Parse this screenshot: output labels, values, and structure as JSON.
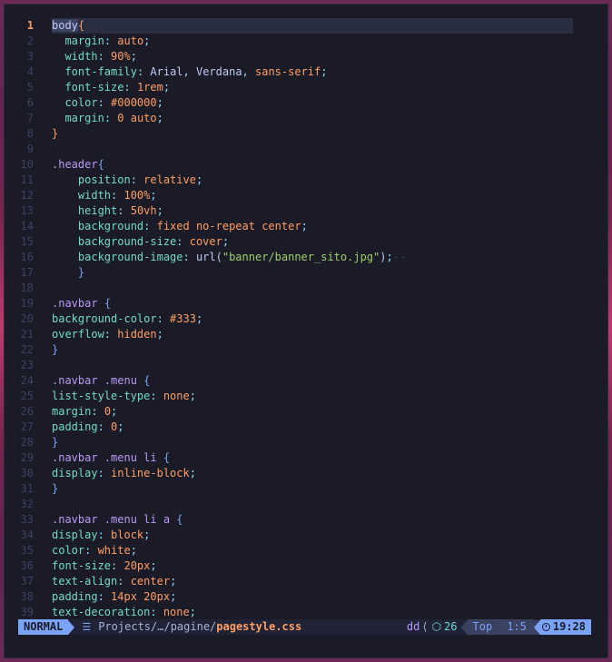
{
  "colors": {
    "background": "#1a1b26",
    "accent": "#7aa2f7",
    "selector": "#bb9af7",
    "property": "#7dcfff",
    "value": "#ff9e64",
    "string": "#9ece6a"
  },
  "editor": {
    "current_line": 1,
    "lines": [
      {
        "n": "1",
        "tokens": [
          [
            "t-hl",
            "body"
          ],
          [
            "t-brace",
            "{"
          ]
        ]
      },
      {
        "n": "2",
        "tokens": [
          [
            "t-plain",
            "  "
          ],
          [
            "t-prop2",
            "margin"
          ],
          [
            "t-punct",
            ": "
          ],
          [
            "t-val",
            "auto"
          ],
          [
            "t-punct",
            ";"
          ]
        ]
      },
      {
        "n": "3",
        "tokens": [
          [
            "t-plain",
            "  "
          ],
          [
            "t-prop2",
            "width"
          ],
          [
            "t-punct",
            ": "
          ],
          [
            "t-num",
            "90%"
          ],
          [
            "t-punct",
            ";"
          ]
        ]
      },
      {
        "n": "4",
        "tokens": [
          [
            "t-plain",
            "  "
          ],
          [
            "t-prop2",
            "font-family"
          ],
          [
            "t-punct",
            ": "
          ],
          [
            "t-plain",
            "Arial"
          ],
          [
            "t-comma",
            ", "
          ],
          [
            "t-plain",
            "Verdana"
          ],
          [
            "t-comma",
            ", "
          ],
          [
            "t-val",
            "sans-serif"
          ],
          [
            "t-punct",
            ";"
          ]
        ]
      },
      {
        "n": "5",
        "tokens": [
          [
            "t-plain",
            "  "
          ],
          [
            "t-prop2",
            "font-size"
          ],
          [
            "t-punct",
            ": "
          ],
          [
            "t-num",
            "1rem"
          ],
          [
            "t-punct",
            ";"
          ]
        ]
      },
      {
        "n": "6",
        "tokens": [
          [
            "t-plain",
            "  "
          ],
          [
            "t-prop2",
            "color"
          ],
          [
            "t-punct",
            ": "
          ],
          [
            "t-num",
            "#000000"
          ],
          [
            "t-punct",
            ";"
          ]
        ]
      },
      {
        "n": "7",
        "tokens": [
          [
            "t-plain",
            "  "
          ],
          [
            "t-prop2",
            "margin"
          ],
          [
            "t-punct",
            ": "
          ],
          [
            "t-num",
            "0"
          ],
          [
            "t-plain",
            " "
          ],
          [
            "t-val",
            "auto"
          ],
          [
            "t-punct",
            ";"
          ]
        ]
      },
      {
        "n": "8",
        "tokens": [
          [
            "t-brace",
            "}"
          ]
        ]
      },
      {
        "n": "9",
        "tokens": []
      },
      {
        "n": "10",
        "tokens": [
          [
            "t-sel",
            ".header"
          ],
          [
            "t-brace2",
            "{"
          ]
        ]
      },
      {
        "n": "11",
        "tokens": [
          [
            "t-plain",
            "    "
          ],
          [
            "t-prop2",
            "position"
          ],
          [
            "t-punct",
            ": "
          ],
          [
            "t-val",
            "relative"
          ],
          [
            "t-punct",
            ";"
          ]
        ]
      },
      {
        "n": "12",
        "tokens": [
          [
            "t-plain",
            "    "
          ],
          [
            "t-prop2",
            "width"
          ],
          [
            "t-punct",
            ": "
          ],
          [
            "t-num",
            "100%"
          ],
          [
            "t-punct",
            ";"
          ]
        ]
      },
      {
        "n": "13",
        "tokens": [
          [
            "t-plain",
            "    "
          ],
          [
            "t-prop2",
            "height"
          ],
          [
            "t-punct",
            ": "
          ],
          [
            "t-num",
            "50vh"
          ],
          [
            "t-punct",
            ";"
          ]
        ]
      },
      {
        "n": "14",
        "tokens": [
          [
            "t-plain",
            "    "
          ],
          [
            "t-prop2",
            "background"
          ],
          [
            "t-punct",
            ": "
          ],
          [
            "t-val",
            "fixed no-repeat center"
          ],
          [
            "t-punct",
            ";"
          ]
        ]
      },
      {
        "n": "15",
        "tokens": [
          [
            "t-plain",
            "    "
          ],
          [
            "t-prop2",
            "background-size"
          ],
          [
            "t-punct",
            ": "
          ],
          [
            "t-val",
            "cover"
          ],
          [
            "t-punct",
            ";"
          ]
        ]
      },
      {
        "n": "16",
        "tokens": [
          [
            "t-plain",
            "    "
          ],
          [
            "t-prop2",
            "background-image"
          ],
          [
            "t-punct",
            ": "
          ],
          [
            "t-plain",
            "url("
          ],
          [
            "t-str",
            "\"banner/banner_sito.jpg\""
          ],
          [
            "t-plain",
            ")"
          ],
          [
            "t-punct",
            ";"
          ],
          [
            "t-ghost",
            "--"
          ]
        ]
      },
      {
        "n": "17",
        "tokens": [
          [
            "t-plain",
            "    "
          ],
          [
            "t-brace2",
            "}"
          ]
        ]
      },
      {
        "n": "18",
        "tokens": []
      },
      {
        "n": "19",
        "tokens": [
          [
            "t-sel",
            ".navbar"
          ],
          [
            "t-plain",
            " "
          ],
          [
            "t-brace2",
            "{"
          ]
        ]
      },
      {
        "n": "20",
        "tokens": [
          [
            "t-prop2",
            "background-color"
          ],
          [
            "t-punct",
            ": "
          ],
          [
            "t-num",
            "#333"
          ],
          [
            "t-punct",
            ";"
          ]
        ]
      },
      {
        "n": "21",
        "tokens": [
          [
            "t-prop2",
            "overflow"
          ],
          [
            "t-punct",
            ": "
          ],
          [
            "t-val",
            "hidden"
          ],
          [
            "t-punct",
            ";"
          ]
        ]
      },
      {
        "n": "22",
        "tokens": [
          [
            "t-brace2",
            "}"
          ]
        ]
      },
      {
        "n": "23",
        "tokens": []
      },
      {
        "n": "24",
        "tokens": [
          [
            "t-sel",
            ".navbar .menu"
          ],
          [
            "t-plain",
            " "
          ],
          [
            "t-brace2",
            "{"
          ]
        ]
      },
      {
        "n": "25",
        "tokens": [
          [
            "t-prop2",
            "list-style-type"
          ],
          [
            "t-punct",
            ": "
          ],
          [
            "t-val",
            "none"
          ],
          [
            "t-punct",
            ";"
          ]
        ]
      },
      {
        "n": "26",
        "tokens": [
          [
            "t-prop2",
            "margin"
          ],
          [
            "t-punct",
            ": "
          ],
          [
            "t-num",
            "0"
          ],
          [
            "t-punct",
            ";"
          ]
        ]
      },
      {
        "n": "27",
        "tokens": [
          [
            "t-prop2",
            "padding"
          ],
          [
            "t-punct",
            ": "
          ],
          [
            "t-num",
            "0"
          ],
          [
            "t-punct",
            ";"
          ]
        ]
      },
      {
        "n": "28",
        "tokens": [
          [
            "t-brace2",
            "}"
          ]
        ]
      },
      {
        "n": "29",
        "tokens": [
          [
            "t-sel",
            ".navbar .menu li"
          ],
          [
            "t-plain",
            " "
          ],
          [
            "t-brace2",
            "{"
          ]
        ]
      },
      {
        "n": "30",
        "tokens": [
          [
            "t-prop2",
            "display"
          ],
          [
            "t-punct",
            ": "
          ],
          [
            "t-val",
            "inline-block"
          ],
          [
            "t-punct",
            ";"
          ]
        ]
      },
      {
        "n": "31",
        "tokens": [
          [
            "t-brace2",
            "}"
          ]
        ]
      },
      {
        "n": "32",
        "tokens": []
      },
      {
        "n": "33",
        "tokens": [
          [
            "t-sel",
            ".navbar .menu li a"
          ],
          [
            "t-plain",
            " "
          ],
          [
            "t-brace2",
            "{"
          ]
        ]
      },
      {
        "n": "34",
        "tokens": [
          [
            "t-prop2",
            "display"
          ],
          [
            "t-punct",
            ": "
          ],
          [
            "t-val",
            "block"
          ],
          [
            "t-punct",
            ";"
          ]
        ]
      },
      {
        "n": "35",
        "tokens": [
          [
            "t-prop2",
            "color"
          ],
          [
            "t-punct",
            ": "
          ],
          [
            "t-val",
            "white"
          ],
          [
            "t-punct",
            ";"
          ]
        ]
      },
      {
        "n": "36",
        "tokens": [
          [
            "t-prop2",
            "font-size"
          ],
          [
            "t-punct",
            ": "
          ],
          [
            "t-num",
            "20px"
          ],
          [
            "t-punct",
            ";"
          ]
        ]
      },
      {
        "n": "37",
        "tokens": [
          [
            "t-prop2",
            "text-align"
          ],
          [
            "t-punct",
            ": "
          ],
          [
            "t-val",
            "center"
          ],
          [
            "t-punct",
            ";"
          ]
        ]
      },
      {
        "n": "38",
        "tokens": [
          [
            "t-prop2",
            "padding"
          ],
          [
            "t-punct",
            ": "
          ],
          [
            "t-num",
            "14px 20px"
          ],
          [
            "t-punct",
            ";"
          ]
        ]
      },
      {
        "n": "39",
        "tokens": [
          [
            "t-prop2",
            "text-decoration"
          ],
          [
            "t-punct",
            ": "
          ],
          [
            "t-val",
            "none"
          ],
          [
            "t-punct",
            ";"
          ]
        ]
      }
    ]
  },
  "statusline": {
    "mode": "NORMAL",
    "file_icon": "file-icon",
    "path": "Projects/…/pagine/",
    "filename": "pagestyle.css",
    "user": "dd",
    "lsp_icon": "cube-icon",
    "lsp_count": "26",
    "scroll": "Top",
    "cursor": "1:5",
    "clock_icon": "clock-icon",
    "time": "19:28"
  }
}
